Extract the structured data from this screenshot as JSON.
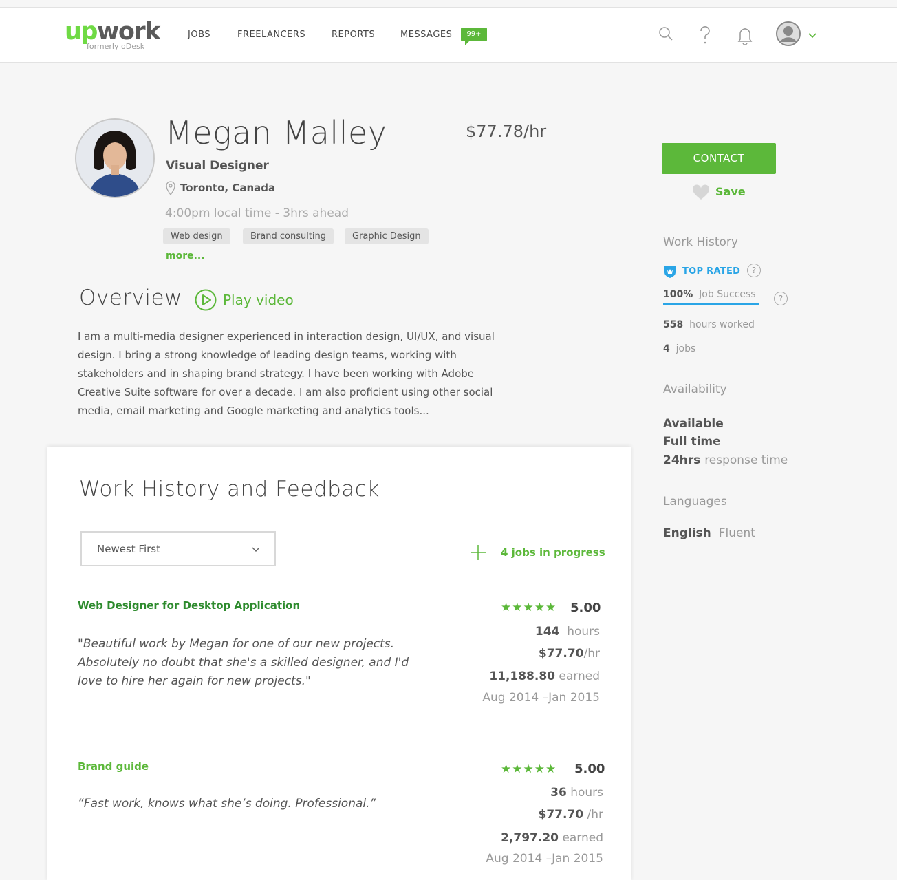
{
  "brand": {
    "logo_up": "up",
    "logo_work": "work",
    "tagline": "formerly oDesk",
    "accent": "#5cb83a",
    "blue": "#2aa5e6"
  },
  "nav": {
    "jobs": "JOBS",
    "freelancers": "FREELANCERS",
    "reports": "REPORTS",
    "messages": "MESSAGES",
    "messages_badge": "99+"
  },
  "header_icons": [
    "search-icon",
    "help-icon",
    "bell-icon",
    "user-avatar-icon",
    "chevron-down-icon"
  ],
  "profile": {
    "name": "Megan Malley",
    "rate": "$77.78/hr",
    "title": "Visual Designer",
    "location": "Toronto, Canada",
    "local_time": "4:00pm local time - 3hrs ahead",
    "skills": [
      "Web design",
      "Brand consulting",
      "Graphic Design"
    ],
    "more": "more..."
  },
  "overview": {
    "heading": "Overview",
    "play_video": "Play video",
    "text": "I am a multi-media designer experienced in interaction design, UI/UX, and visual design. I bring a strong knowledge of leading design teams, working with stakeholders and in shaping brand strategy. I have been working with Adobe Creative Suite software for over a decade. I am also proficient using other social media, email marketing and Google marketing and analytics tools..."
  },
  "work_history": {
    "heading": "Work History and Feedback",
    "sort_selected": "Newest First",
    "jobs_in_progress": "4 jobs in progress",
    "jobs": [
      {
        "title": "Web Designer for Desktop Application",
        "title_color": "#2e8b2e",
        "quote": "\"Beautiful work by Megan for one of our new projects. Absolutely no doubt that she's a skilled designer, and I'd love to hire her again for new projects.\"",
        "stars": "★★★★★",
        "rating": "5.00",
        "hours": "144",
        "hours_label": "hours",
        "rate": "$77.70",
        "rate_label": "/hr",
        "earned": "11,188.80",
        "earned_label": "earned",
        "dates": "Aug 2014 –Jan 2015"
      },
      {
        "title": "Brand guide",
        "title_color": "#5cb83a",
        "quote": "“Fast work, knows what she’s doing. Professional.”",
        "stars": "★★★★★",
        "rating": "5.00",
        "hours": "36",
        "hours_label": "hours",
        "rate": "$77.70",
        "rate_label": "/hr",
        "earned": "2,797.20",
        "earned_label": "earned",
        "dates": "Aug 2014 –Jan 2015"
      }
    ]
  },
  "sidebar": {
    "contact": "CONTACT",
    "save": "Save",
    "work_history_heading": "Work History",
    "top_rated": "TOP RATED",
    "job_success_value": "100%",
    "job_success_label": "Job Success",
    "job_success_progress": 1.0,
    "hours_worked_value": "558",
    "hours_worked_label": "hours worked",
    "jobs_value": "4",
    "jobs_label": "jobs",
    "availability_heading": "Availability",
    "available": "Available",
    "full_time": "Full time",
    "response_value": "24hrs",
    "response_label": "response time",
    "languages_heading": "Languages",
    "language": "English",
    "language_level": "Fluent"
  }
}
